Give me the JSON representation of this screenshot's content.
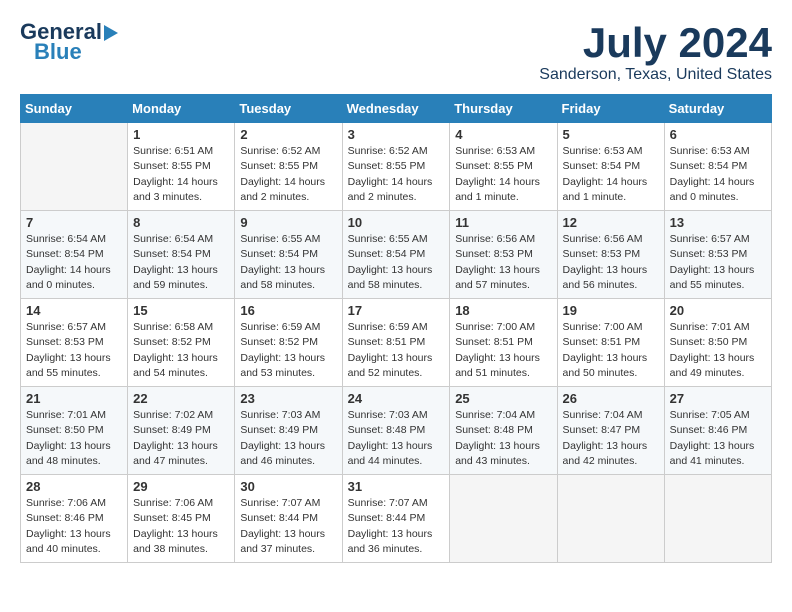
{
  "header": {
    "logo_line1": "General",
    "logo_line2": "Blue",
    "month_title": "July 2024",
    "location": "Sanderson, Texas, United States"
  },
  "weekdays": [
    "Sunday",
    "Monday",
    "Tuesday",
    "Wednesday",
    "Thursday",
    "Friday",
    "Saturday"
  ],
  "weeks": [
    [
      {
        "num": "",
        "info": ""
      },
      {
        "num": "1",
        "info": "Sunrise: 6:51 AM\nSunset: 8:55 PM\nDaylight: 14 hours\nand 3 minutes."
      },
      {
        "num": "2",
        "info": "Sunrise: 6:52 AM\nSunset: 8:55 PM\nDaylight: 14 hours\nand 2 minutes."
      },
      {
        "num": "3",
        "info": "Sunrise: 6:52 AM\nSunset: 8:55 PM\nDaylight: 14 hours\nand 2 minutes."
      },
      {
        "num": "4",
        "info": "Sunrise: 6:53 AM\nSunset: 8:55 PM\nDaylight: 14 hours\nand 1 minute."
      },
      {
        "num": "5",
        "info": "Sunrise: 6:53 AM\nSunset: 8:54 PM\nDaylight: 14 hours\nand 1 minute."
      },
      {
        "num": "6",
        "info": "Sunrise: 6:53 AM\nSunset: 8:54 PM\nDaylight: 14 hours\nand 0 minutes."
      }
    ],
    [
      {
        "num": "7",
        "info": "Sunrise: 6:54 AM\nSunset: 8:54 PM\nDaylight: 14 hours\nand 0 minutes."
      },
      {
        "num": "8",
        "info": "Sunrise: 6:54 AM\nSunset: 8:54 PM\nDaylight: 13 hours\nand 59 minutes."
      },
      {
        "num": "9",
        "info": "Sunrise: 6:55 AM\nSunset: 8:54 PM\nDaylight: 13 hours\nand 58 minutes."
      },
      {
        "num": "10",
        "info": "Sunrise: 6:55 AM\nSunset: 8:54 PM\nDaylight: 13 hours\nand 58 minutes."
      },
      {
        "num": "11",
        "info": "Sunrise: 6:56 AM\nSunset: 8:53 PM\nDaylight: 13 hours\nand 57 minutes."
      },
      {
        "num": "12",
        "info": "Sunrise: 6:56 AM\nSunset: 8:53 PM\nDaylight: 13 hours\nand 56 minutes."
      },
      {
        "num": "13",
        "info": "Sunrise: 6:57 AM\nSunset: 8:53 PM\nDaylight: 13 hours\nand 55 minutes."
      }
    ],
    [
      {
        "num": "14",
        "info": "Sunrise: 6:57 AM\nSunset: 8:53 PM\nDaylight: 13 hours\nand 55 minutes."
      },
      {
        "num": "15",
        "info": "Sunrise: 6:58 AM\nSunset: 8:52 PM\nDaylight: 13 hours\nand 54 minutes."
      },
      {
        "num": "16",
        "info": "Sunrise: 6:59 AM\nSunset: 8:52 PM\nDaylight: 13 hours\nand 53 minutes."
      },
      {
        "num": "17",
        "info": "Sunrise: 6:59 AM\nSunset: 8:51 PM\nDaylight: 13 hours\nand 52 minutes."
      },
      {
        "num": "18",
        "info": "Sunrise: 7:00 AM\nSunset: 8:51 PM\nDaylight: 13 hours\nand 51 minutes."
      },
      {
        "num": "19",
        "info": "Sunrise: 7:00 AM\nSunset: 8:51 PM\nDaylight: 13 hours\nand 50 minutes."
      },
      {
        "num": "20",
        "info": "Sunrise: 7:01 AM\nSunset: 8:50 PM\nDaylight: 13 hours\nand 49 minutes."
      }
    ],
    [
      {
        "num": "21",
        "info": "Sunrise: 7:01 AM\nSunset: 8:50 PM\nDaylight: 13 hours\nand 48 minutes."
      },
      {
        "num": "22",
        "info": "Sunrise: 7:02 AM\nSunset: 8:49 PM\nDaylight: 13 hours\nand 47 minutes."
      },
      {
        "num": "23",
        "info": "Sunrise: 7:03 AM\nSunset: 8:49 PM\nDaylight: 13 hours\nand 46 minutes."
      },
      {
        "num": "24",
        "info": "Sunrise: 7:03 AM\nSunset: 8:48 PM\nDaylight: 13 hours\nand 44 minutes."
      },
      {
        "num": "25",
        "info": "Sunrise: 7:04 AM\nSunset: 8:48 PM\nDaylight: 13 hours\nand 43 minutes."
      },
      {
        "num": "26",
        "info": "Sunrise: 7:04 AM\nSunset: 8:47 PM\nDaylight: 13 hours\nand 42 minutes."
      },
      {
        "num": "27",
        "info": "Sunrise: 7:05 AM\nSunset: 8:46 PM\nDaylight: 13 hours\nand 41 minutes."
      }
    ],
    [
      {
        "num": "28",
        "info": "Sunrise: 7:06 AM\nSunset: 8:46 PM\nDaylight: 13 hours\nand 40 minutes."
      },
      {
        "num": "29",
        "info": "Sunrise: 7:06 AM\nSunset: 8:45 PM\nDaylight: 13 hours\nand 38 minutes."
      },
      {
        "num": "30",
        "info": "Sunrise: 7:07 AM\nSunset: 8:44 PM\nDaylight: 13 hours\nand 37 minutes."
      },
      {
        "num": "31",
        "info": "Sunrise: 7:07 AM\nSunset: 8:44 PM\nDaylight: 13 hours\nand 36 minutes."
      },
      {
        "num": "",
        "info": ""
      },
      {
        "num": "",
        "info": ""
      },
      {
        "num": "",
        "info": ""
      }
    ]
  ]
}
